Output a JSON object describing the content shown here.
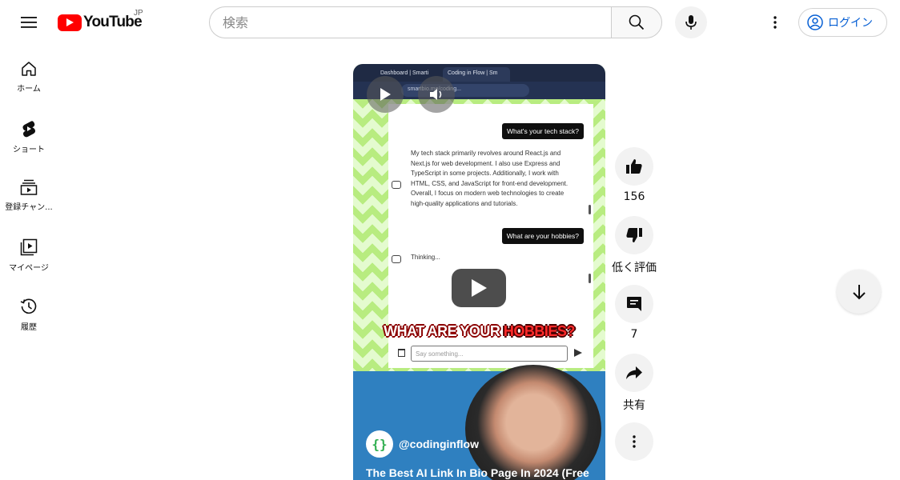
{
  "header": {
    "logo_text": "YouTube",
    "region": "JP",
    "search_placeholder": "検索",
    "login_label": "ログイン"
  },
  "sidebar": {
    "items": [
      {
        "label": "ホーム",
        "icon": "home-icon"
      },
      {
        "label": "ショート",
        "icon": "shorts-icon"
      },
      {
        "label": "登録チャン...",
        "icon": "subscriptions-icon"
      },
      {
        "label": "マイページ",
        "icon": "library-icon"
      },
      {
        "label": "履歴",
        "icon": "history-icon"
      }
    ]
  },
  "video": {
    "browser_tabs": [
      "Dashboard | Smarti",
      "Coding in Flow | Sm"
    ],
    "address": "smartbio.me/coding...",
    "chat": {
      "user_message_1": "What's your tech stack?",
      "bot_message_1": "My tech stack primarily revolves around React.js and Next.js for web development. I also use Express and TypeScript in some projects. Additionally, I work with HTML, CSS, and JavaScript for front-end development. Overall, I focus on modern web technologies to create high-quality applications and tutorials.",
      "user_message_2": "What are your hobbies?",
      "bot_thinking": "Thinking...",
      "input_placeholder": "Say something..."
    },
    "caption_parts": [
      "WHAT ARE YOUR ",
      "HOBBIES?"
    ],
    "channel_avatar_text": "{}",
    "channel_handle": "@codinginflow",
    "title": "The Best AI Link In Bio Page In 2024 (Free"
  },
  "actions": {
    "like_count": "156",
    "dislike_label": "低く評価",
    "comment_count": "7",
    "share_label": "共有"
  },
  "colors": {
    "brand_red": "#ff0000",
    "link_blue": "#065fd4",
    "video_blue_panel": "#2f80c0"
  }
}
